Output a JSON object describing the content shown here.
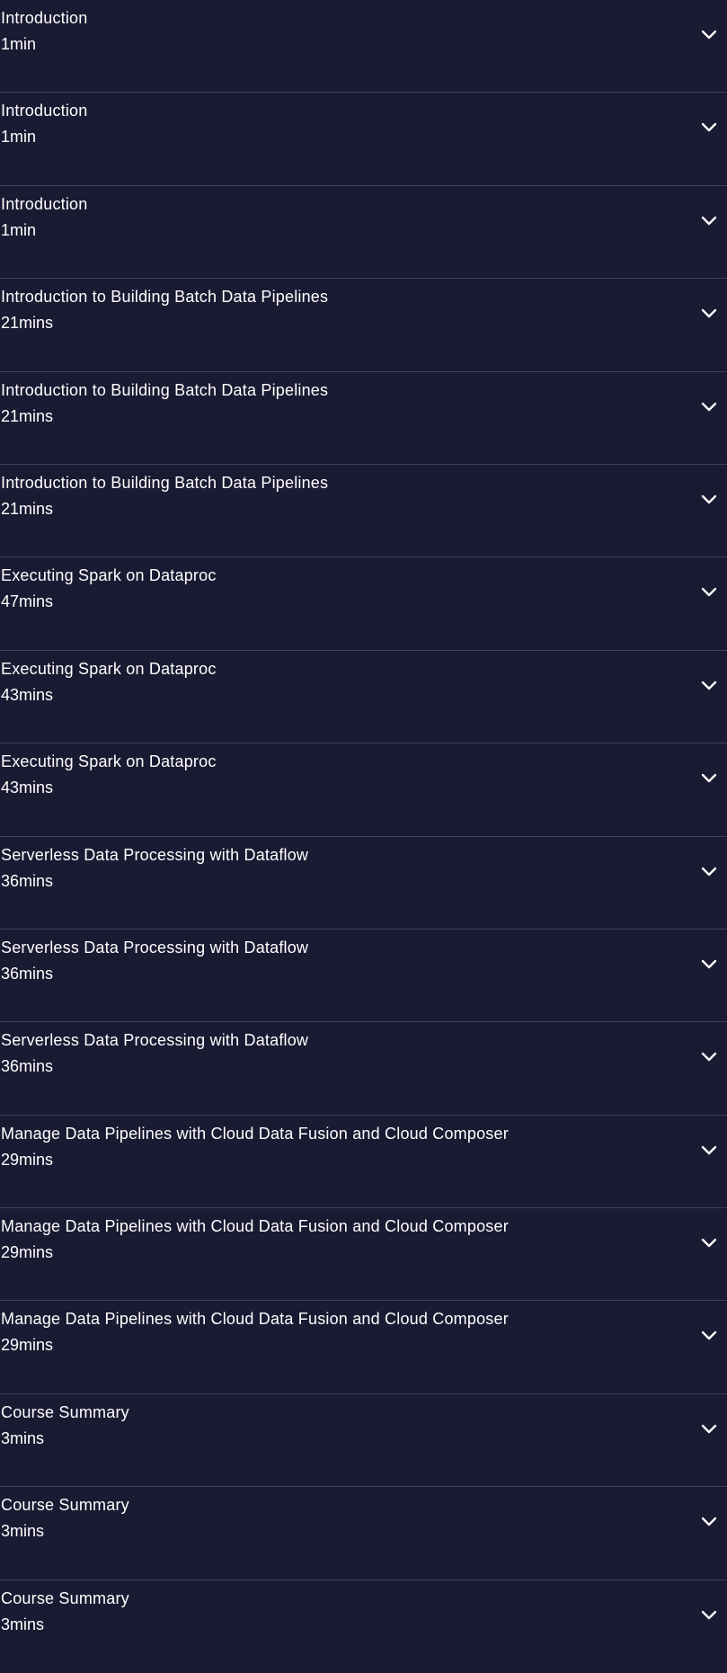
{
  "modules": [
    {
      "title": "Introduction",
      "duration": "1min"
    },
    {
      "title": "Introduction",
      "duration": "1min"
    },
    {
      "title": "Introduction",
      "duration": "1min"
    },
    {
      "title": "Introduction to Building Batch Data Pipelines",
      "duration": "21mins"
    },
    {
      "title": "Introduction to Building Batch Data Pipelines",
      "duration": "21mins"
    },
    {
      "title": "Introduction to Building Batch Data Pipelines",
      "duration": "21mins"
    },
    {
      "title": "Executing Spark on Dataproc",
      "duration": "47mins"
    },
    {
      "title": "Executing Spark on Dataproc",
      "duration": "43mins"
    },
    {
      "title": "Executing Spark on Dataproc",
      "duration": "43mins"
    },
    {
      "title": "Serverless Data Processing with Dataflow",
      "duration": "36mins"
    },
    {
      "title": "Serverless Data Processing with Dataflow",
      "duration": "36mins"
    },
    {
      "title": "Serverless Data Processing with Dataflow",
      "duration": "36mins"
    },
    {
      "title": "Manage Data Pipelines with Cloud Data Fusion and Cloud Composer",
      "duration": "29mins"
    },
    {
      "title": "Manage Data Pipelines with Cloud Data Fusion and Cloud Composer",
      "duration": "29mins"
    },
    {
      "title": "Manage Data Pipelines with Cloud Data Fusion and Cloud Composer",
      "duration": "29mins"
    },
    {
      "title": "Course Summary",
      "duration": "3mins"
    },
    {
      "title": "Course Summary",
      "duration": "3mins"
    },
    {
      "title": "Course Summary",
      "duration": "3mins"
    }
  ],
  "icons": {
    "expand": "chevron-down-icon"
  },
  "colors": {
    "background": "#1a1a33",
    "divider": "#3f3f66",
    "text": "#ffffff"
  }
}
